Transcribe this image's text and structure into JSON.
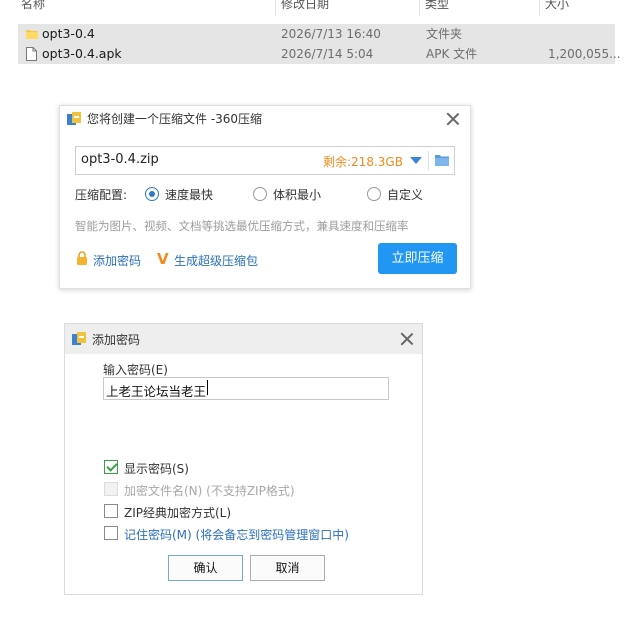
{
  "explorer": {
    "columns": [
      "名称",
      "修改日期",
      "类型",
      "大小"
    ],
    "files": [
      {
        "name": "opt3-0.4",
        "date": "2026/7/13 16:40",
        "type": "文件夹",
        "size": "",
        "icon": "folder-icon"
      },
      {
        "name": "opt3-0.4.apk",
        "date": "2026/7/14 5:04",
        "type": "APK 文件",
        "size": "1,200,055...",
        "icon": "file-icon"
      }
    ]
  },
  "compress_dialog": {
    "title": "您将创建一个压缩文件 -360压缩",
    "filename": "opt3-0.4.zip",
    "free_space": "剩余:218.3GB",
    "config_label": "压缩配置:",
    "options": [
      "速度最快",
      "体积最小",
      "自定义"
    ],
    "selected_option": "速度最快",
    "hint": "智能为图片、视频、文档等挑选最优压缩方式，兼具速度和压缩率",
    "add_password_link": "添加密码",
    "super_pack_link": "生成超级压缩包",
    "compress_button": "立即压缩",
    "colors": {
      "accent": "#2196f3",
      "free_space": "#f08a1c",
      "link": "#2b6fc0"
    }
  },
  "password_dialog": {
    "title": "添加密码",
    "input_label": "输入密码(E)",
    "password_value": "上老王论坛当老王",
    "checkboxes": [
      {
        "label": "显示密码(S)",
        "checked": true,
        "enabled": true
      },
      {
        "label": "加密文件名(N) (不支持ZIP格式)",
        "checked": false,
        "enabled": false
      },
      {
        "label": "ZIP经典加密方式(L)",
        "checked": false,
        "enabled": true
      },
      {
        "label": "记住密码(M) (将会备忘到密码管理窗口中)",
        "checked": false,
        "enabled": true
      }
    ],
    "ok_button": "确认",
    "cancel_button": "取消"
  }
}
